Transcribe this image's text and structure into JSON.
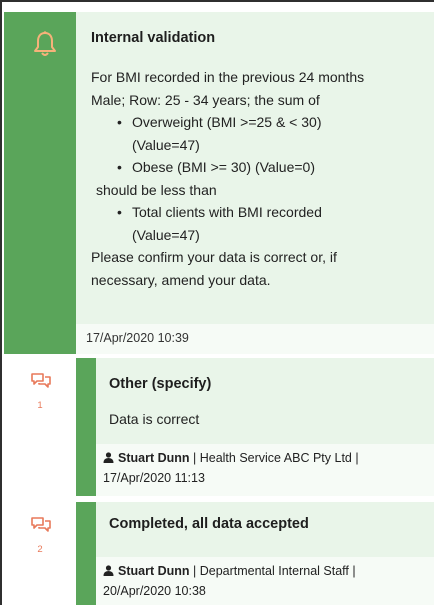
{
  "validation": {
    "title": "Internal validation",
    "lines": {
      "l1": "For BMI recorded in the previous 24 months",
      "l2": "Male; Row: 25 - 34 years; the sum of",
      "l3": "Overweight (BMI >=25 & < 30)",
      "l4": "(Value=47)",
      "l5": "Obese (BMI >= 30) (Value=0)",
      "l6": "should be less than",
      "l7": "Total clients with BMI recorded",
      "l8": "(Value=47)",
      "l9": "Please confirm your data is correct or, if",
      "l10": "necessary, amend your data."
    },
    "bullet": "•",
    "timestamp": "17/Apr/2020 10:39"
  },
  "comments": [
    {
      "number": "1",
      "title": "Other (specify)",
      "text": "Data is correct",
      "author": "Stuart Dunn",
      "meta_line1": " | Health Service ABC Pty Ltd |",
      "meta_line2": "17/Apr/2020 11:13"
    },
    {
      "number": "2",
      "title": "Completed, all data accepted",
      "text": "",
      "author": "Stuart Dunn",
      "meta_line1": " | Departmental Internal Staff |",
      "meta_line2": "20/Apr/2020 10:38"
    }
  ],
  "colors": {
    "sidebar_green": "#5aa55a",
    "panel_bg": "#e9f5e9",
    "icon_orange": "#e8795a",
    "bell_orange": "#f0a060"
  },
  "icons": {
    "alert": "bell-icon",
    "comment": "comments-icon",
    "author": "user-icon"
  }
}
